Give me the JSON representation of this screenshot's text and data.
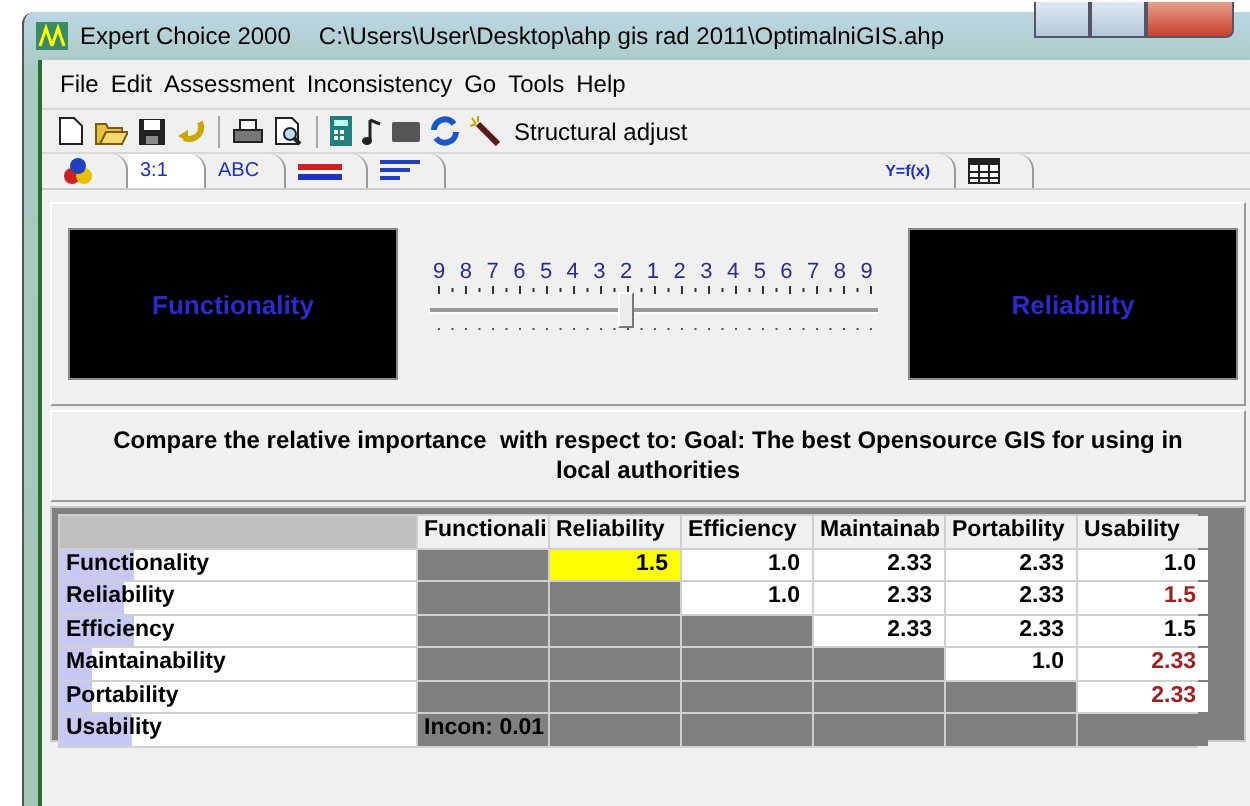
{
  "window": {
    "app_title": "Expert Choice 2000",
    "file_path": "C:\\Users\\User\\Desktop\\ahp gis rad 2011\\OptimalniGIS.ahp"
  },
  "menu": [
    {
      "label": "File"
    },
    {
      "label": "Edit"
    },
    {
      "label": "Assessment"
    },
    {
      "label": "Inconsistency"
    },
    {
      "label": "Go"
    },
    {
      "label": "Tools"
    },
    {
      "label": "Help"
    }
  ],
  "toolbar": {
    "structural_adjust": {
      "label": "Structural adjust"
    }
  },
  "tabs": [
    {
      "selected": false
    },
    {
      "label": "3:1",
      "selected": true
    },
    {
      "label": "ABC",
      "selected": false
    },
    {
      "selected": false
    },
    {
      "selected": false
    },
    {
      "label": "Y=f(x)",
      "selected": false
    },
    {
      "selected": false
    }
  ],
  "comparison": {
    "left": "Functionality",
    "right": "Reliability",
    "scale": [
      "9",
      "8",
      "7",
      "6",
      "5",
      "4",
      "3",
      "2",
      "1",
      "2",
      "3",
      "4",
      "5",
      "6",
      "7",
      "8",
      "9"
    ],
    "level": 0.44
  },
  "question": "Compare the relative importance  with respect to: Goal: The best Opensource GIS for using in local authorities",
  "matrix": {
    "columns": [
      "Functionali",
      "Reliability",
      "Efficiency",
      "Maintainab",
      "Portability",
      "Usability"
    ],
    "rows": [
      {
        "label": "Functionality",
        "level": 0.21,
        "cells": [
          {
            "kind": "shaded"
          },
          {
            "kind": "value",
            "text": "1.5",
            "inverted": false,
            "selected": true
          },
          {
            "kind": "value",
            "text": "1.0",
            "inverted": false,
            "selected": false
          },
          {
            "kind": "value",
            "text": "2.33",
            "inverted": false,
            "selected": false
          },
          {
            "kind": "value",
            "text": "2.33",
            "inverted": false,
            "selected": false
          },
          {
            "kind": "value",
            "text": "1.0",
            "inverted": false,
            "selected": false
          }
        ]
      },
      {
        "label": "Reliability",
        "level": 0.18,
        "cells": [
          {
            "kind": "shaded"
          },
          {
            "kind": "shaded"
          },
          {
            "kind": "value",
            "text": "1.0",
            "inverted": false,
            "selected": false
          },
          {
            "kind": "value",
            "text": "2.33",
            "inverted": false,
            "selected": false
          },
          {
            "kind": "value",
            "text": "2.33",
            "inverted": false,
            "selected": false
          },
          {
            "kind": "value",
            "text": "1.5",
            "inverted": true,
            "selected": false
          }
        ]
      },
      {
        "label": "Efficiency",
        "level": 0.21,
        "cells": [
          {
            "kind": "shaded"
          },
          {
            "kind": "shaded"
          },
          {
            "kind": "shaded"
          },
          {
            "kind": "value",
            "text": "2.33",
            "inverted": false,
            "selected": false
          },
          {
            "kind": "value",
            "text": "2.33",
            "inverted": false,
            "selected": false
          },
          {
            "kind": "value",
            "text": "1.5",
            "inverted": false,
            "selected": false
          }
        ]
      },
      {
        "label": "Maintainability",
        "level": 0.09,
        "cells": [
          {
            "kind": "shaded"
          },
          {
            "kind": "shaded"
          },
          {
            "kind": "shaded"
          },
          {
            "kind": "shaded"
          },
          {
            "kind": "value",
            "text": "1.0",
            "inverted": false,
            "selected": false
          },
          {
            "kind": "value",
            "text": "2.33",
            "inverted": true,
            "selected": false
          }
        ]
      },
      {
        "label": "Portability",
        "level": 0.09,
        "cells": [
          {
            "kind": "shaded"
          },
          {
            "kind": "shaded"
          },
          {
            "kind": "shaded"
          },
          {
            "kind": "shaded"
          },
          {
            "kind": "shaded"
          },
          {
            "kind": "value",
            "text": "2.33",
            "inverted": true,
            "selected": false
          }
        ]
      },
      {
        "label": "Usability",
        "level": 0.2,
        "cells": [
          {
            "kind": "note",
            "text": "Incon: 0.01"
          },
          {
            "kind": "shaded"
          },
          {
            "kind": "shaded"
          },
          {
            "kind": "shaded"
          },
          {
            "kind": "shaded"
          },
          {
            "kind": "shaded"
          }
        ]
      }
    ]
  }
}
